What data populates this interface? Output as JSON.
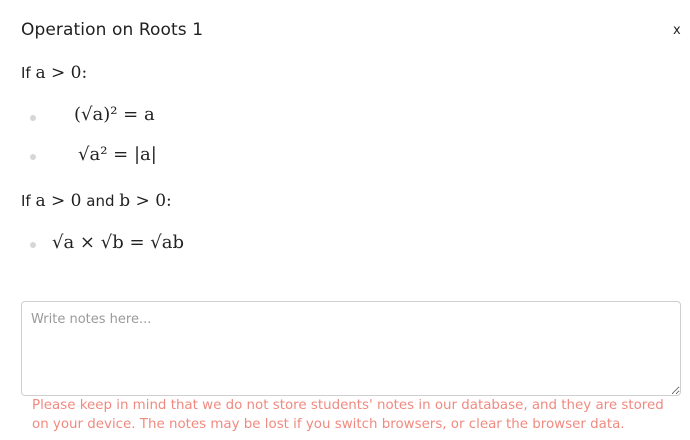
{
  "dialog": {
    "title": "Operation on Roots 1",
    "close_label": "x"
  },
  "sections": [
    {
      "condition_prefix": "If ",
      "condition_math": "a > 0:",
      "formulas": [
        "(√a)² = a",
        "√a² = |a|"
      ]
    },
    {
      "condition_prefix": "If ",
      "condition_math_1": "a > 0",
      "condition_joiner": " and ",
      "condition_math_2": "b > 0:",
      "formulas": [
        "√a × √b = √ab"
      ]
    }
  ],
  "notes": {
    "placeholder": "Write notes here...",
    "value": ""
  },
  "warning": "Please keep in mind that we do not store students' notes in our database, and they are stored on your device. The notes may be lost if you switch browsers, or clear the browser data."
}
